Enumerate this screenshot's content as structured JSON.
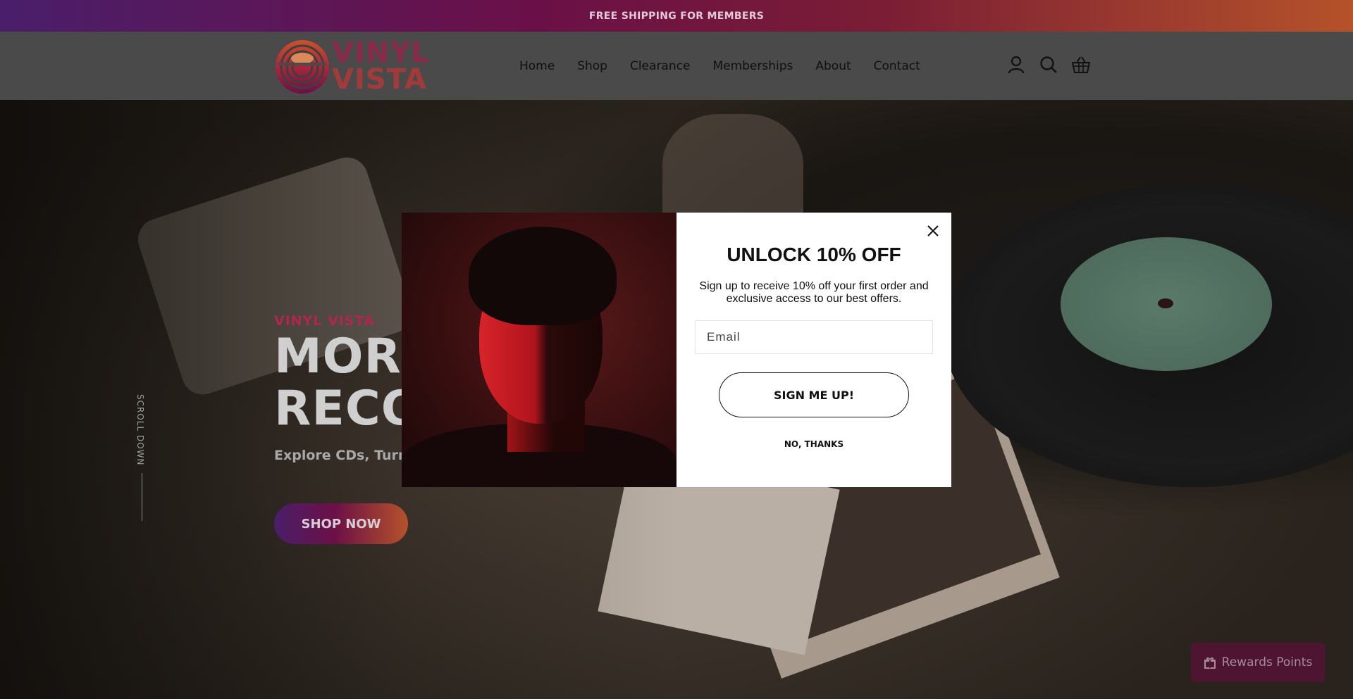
{
  "announcement": {
    "text": "FREE SHIPPING FOR MEMBERS"
  },
  "header": {
    "logo_text_line1": "VINYL",
    "logo_text_line2": "VISTA",
    "nav": [
      "Home",
      "Shop",
      "Clearance",
      "Memberships",
      "About",
      "Contact"
    ],
    "icons": [
      "account-icon",
      "search-icon",
      "cart-basket-icon"
    ]
  },
  "hero": {
    "brand": "VINYL VISTA",
    "title_line1": "MORE",
    "title_line2": "RECO",
    "subtitle": "Explore CDs, Turnta",
    "cta": "SHOP NOW",
    "scroll": "SCROLL DOWN"
  },
  "modal": {
    "title": "UNLOCK 10% OFF",
    "description": "Sign up to receive 10% off your first order and exclusive access to our best offers.",
    "email_placeholder": "Email",
    "submit": "SIGN ME UP!",
    "decline": "NO, THANKS"
  },
  "rewards": {
    "label": "Rewards Points"
  },
  "colors": {
    "brand_purple": "#4a1e6a",
    "brand_magenta": "#6b1047",
    "brand_orange": "#b5522a",
    "brand_red": "#b0264e"
  }
}
